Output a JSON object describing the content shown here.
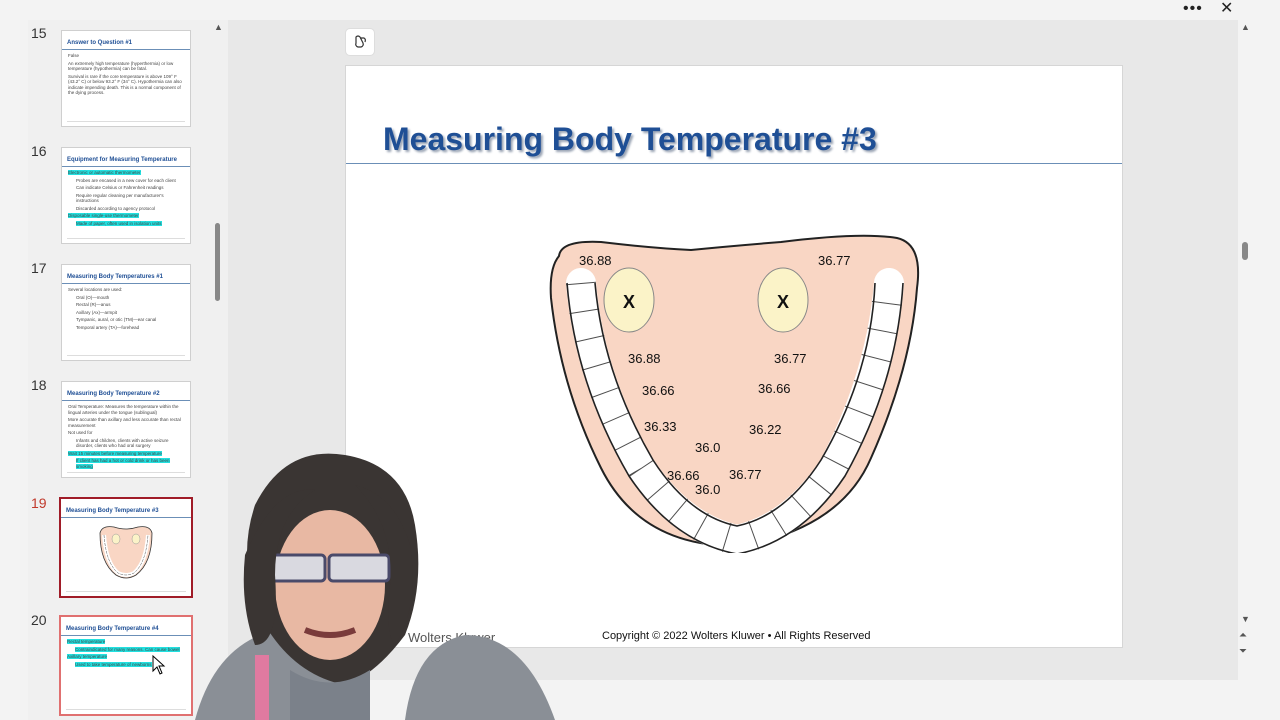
{
  "window": {
    "more_label": "•••",
    "close_label": "✕"
  },
  "thumbnails": [
    {
      "number": "15",
      "title": "Answer to Question #1",
      "lines": [
        "False",
        "An extremely high temperature (hyperthermia) or low temperature (hypothermia) can be fatal.",
        "Survival is rare if the core temperature is above 109° F (43.2° C) or below 93.2° F (34° C). Hypothermia can also indicate impending death. This is a normal component of the dying process."
      ]
    },
    {
      "number": "16",
      "title": "Equipment for Measuring Temperature",
      "lines": [
        "Electronic or automatic thermometer",
        "Probes are encased in a new cover for each client",
        "Can indicate Celsius or Fahrenheit readings",
        "Require regular cleaning per manufacturer's instructions",
        "Discarded according to agency protocol",
        "Disposable single-use thermometer",
        "Made of paper, often used in isolation units"
      ]
    },
    {
      "number": "17",
      "title": "Measuring Body Temperatures #1",
      "lines": [
        "Several locations are used:",
        "Oral (O)—mouth",
        "Rectal (R)—anus",
        "Axillary (Ax)—armpit",
        "Tympanic, aural, or otic (TM)—ear canal",
        "Temporal artery (TA)—forehead"
      ]
    },
    {
      "number": "18",
      "title": "Measuring Body Temperature #2",
      "lines": [
        "Oral Temperature: Measures the temperature within the lingual arteries under the tongue (sublingual)",
        "More accurate than axillary and less accurate than rectal measurement",
        "Not used for",
        "Infants and children, clients with active seizure disorder, clients who had oral surgery",
        "Wait 15 minutes before measuring temperature",
        "If client has had a hot or cold drink or has been smoking"
      ]
    },
    {
      "number": "19",
      "title": "Measuring Body Temperature #3",
      "lines": []
    },
    {
      "number": "20",
      "title": "Measuring Body Temperature #4",
      "lines": [
        "Rectal temperature",
        "Contraindicated for many reasons. Can cause bowel",
        "Axillary temperature",
        "Used to take temperature of newborns"
      ]
    }
  ],
  "slide": {
    "title": "Measuring Body Temperature #3",
    "logo": "Wolters Kluwer",
    "copyright": "Copyright © 2022 Wolters Kluwer • All Rights Reserved",
    "diagram": {
      "left_labels": [
        "36.88",
        "36.88",
        "36.66",
        "36.33",
        "36.66"
      ],
      "right_labels": [
        "36.77",
        "36.77",
        "36.66",
        "36.22",
        "36.77"
      ],
      "center_labels": [
        "36.0",
        "36.0"
      ],
      "marker": "X"
    }
  },
  "colors": {
    "title_blue": "#1f4f95",
    "active_thumb_border": "#a01c28",
    "highlight": "#22e0e0",
    "gum_fill": "#f9d6c4",
    "gland_fill": "#fbf3c8"
  }
}
